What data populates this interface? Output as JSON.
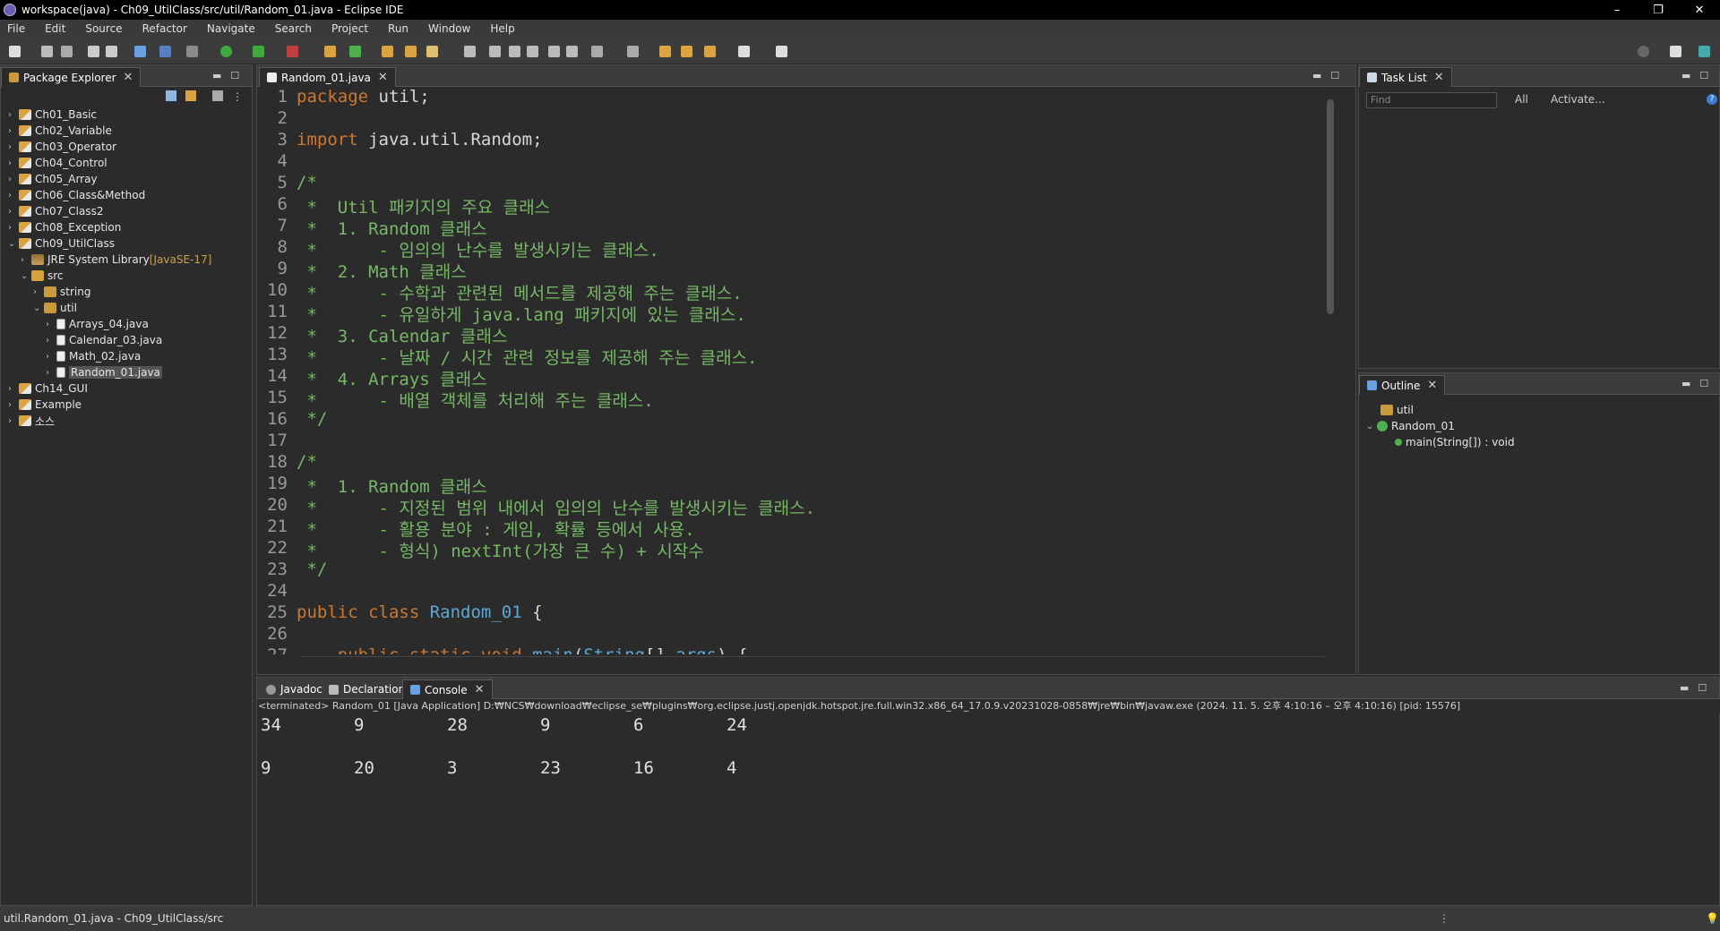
{
  "window": {
    "title": "workspace(java) - Ch09_UtilClass/src/util/Random_01.java - Eclipse IDE",
    "controls": [
      "–",
      "❐",
      "✕"
    ]
  },
  "menu": [
    "File",
    "Edit",
    "Source",
    "Refactor",
    "Navigate",
    "Search",
    "Project",
    "Run",
    "Window",
    "Help"
  ],
  "package_explorer": {
    "tab_label": "Package Explorer",
    "items": [
      {
        "label": "Ch01_Basic",
        "level": 0,
        "icon": "project-icon"
      },
      {
        "label": "Ch02_Variable",
        "level": 0,
        "icon": "project-icon"
      },
      {
        "label": "Ch03_Operator",
        "level": 0,
        "icon": "project-icon"
      },
      {
        "label": "Ch04_Control",
        "level": 0,
        "icon": "project-icon"
      },
      {
        "label": "Ch05_Array",
        "level": 0,
        "icon": "project-icon"
      },
      {
        "label": "Ch06_Class&Method",
        "level": 0,
        "icon": "project-icon"
      },
      {
        "label": "Ch07_Class2",
        "level": 0,
        "icon": "project-icon"
      },
      {
        "label": "Ch08_Exception",
        "level": 0,
        "icon": "project-icon"
      },
      {
        "label": "Ch09_UtilClass",
        "level": 0,
        "icon": "project-icon",
        "expanded": true
      },
      {
        "label": "JRE System Library",
        "suffix": "[JavaSE-17]",
        "level": 1,
        "icon": "library-icon"
      },
      {
        "label": "src",
        "level": 1,
        "icon": "folder-icon",
        "expanded": true
      },
      {
        "label": "string",
        "level": 2,
        "icon": "package-icon"
      },
      {
        "label": "util",
        "level": 2,
        "icon": "package-icon",
        "expanded": true
      },
      {
        "label": "Arrays_04.java",
        "level": 3,
        "icon": "java-file-icon"
      },
      {
        "label": "Calendar_03.java",
        "level": 3,
        "icon": "java-file-icon"
      },
      {
        "label": "Math_02.java",
        "level": 3,
        "icon": "java-file-icon"
      },
      {
        "label": "Random_01.java",
        "level": 3,
        "icon": "java-file-icon",
        "selected": true
      },
      {
        "label": "Ch14_GUI",
        "level": 0,
        "icon": "project-icon"
      },
      {
        "label": "Example",
        "level": 0,
        "icon": "project-icon"
      },
      {
        "label": "소스",
        "level": 0,
        "icon": "project-icon"
      }
    ]
  },
  "editor": {
    "tab_label": "Random_01.java",
    "lines": [
      {
        "n": "1",
        "parts": [
          [
            "kw",
            "package"
          ],
          [
            "pl",
            " util;"
          ]
        ]
      },
      {
        "n": "2",
        "parts": []
      },
      {
        "n": "3",
        "parts": [
          [
            "kw",
            "import"
          ],
          [
            "pl",
            " java.util.Random;"
          ]
        ]
      },
      {
        "n": "4",
        "parts": []
      },
      {
        "n": "5",
        "parts": [
          [
            "cm",
            "/*"
          ]
        ]
      },
      {
        "n": "6",
        "parts": [
          [
            "cm",
            " *  Util 패키지의 주요 클래스"
          ]
        ]
      },
      {
        "n": "7",
        "parts": [
          [
            "cm",
            " *  1. Random 클래스"
          ]
        ]
      },
      {
        "n": "8",
        "parts": [
          [
            "cm",
            " *      - 임의의 난수를 발생시키는 클래스."
          ]
        ]
      },
      {
        "n": "9",
        "parts": [
          [
            "cm",
            " *  2. Math 클래스"
          ]
        ]
      },
      {
        "n": "10",
        "parts": [
          [
            "cm",
            " *      - 수학과 관련된 메서드를 제공해 주는 클래스."
          ]
        ]
      },
      {
        "n": "11",
        "parts": [
          [
            "cm",
            " *      - 유일하게 java.lang 패키지에 있는 클래스."
          ]
        ]
      },
      {
        "n": "12",
        "parts": [
          [
            "cm",
            " *  3. Calendar 클래스"
          ]
        ]
      },
      {
        "n": "13",
        "parts": [
          [
            "cm",
            " *      - 날짜 / 시간 관련 정보를 제공해 주는 클래스."
          ]
        ]
      },
      {
        "n": "14",
        "parts": [
          [
            "cm",
            " *  4. Arrays 클래스"
          ]
        ]
      },
      {
        "n": "15",
        "parts": [
          [
            "cm",
            " *      - 배열 객체를 처리해 주는 클래스."
          ]
        ]
      },
      {
        "n": "16",
        "parts": [
          [
            "cm",
            " */"
          ]
        ]
      },
      {
        "n": "17",
        "parts": []
      },
      {
        "n": "18",
        "parts": [
          [
            "cm",
            "/*"
          ]
        ]
      },
      {
        "n": "19",
        "parts": [
          [
            "cm",
            " *  1. Random 클래스"
          ]
        ]
      },
      {
        "n": "20",
        "parts": [
          [
            "cm",
            " *      - 지정된 범위 내에서 임의의 난수를 발생시키는 클래스."
          ]
        ]
      },
      {
        "n": "21",
        "parts": [
          [
            "cm",
            " *      - 활용 분야 : 게임, 확률 등에서 사용."
          ]
        ]
      },
      {
        "n": "22",
        "parts": [
          [
            "cm",
            " *      - 형식) nextInt(가장 큰 수) + 시작수"
          ]
        ]
      },
      {
        "n": "23",
        "parts": [
          [
            "cm",
            " */"
          ]
        ]
      },
      {
        "n": "24",
        "parts": []
      },
      {
        "n": "25",
        "parts": [
          [
            "kw",
            "public class "
          ],
          [
            "ty",
            "Random_01"
          ],
          [
            "pl",
            " {"
          ]
        ]
      },
      {
        "n": "26",
        "parts": []
      },
      {
        "n": "27",
        "parts": [
          [
            "pl",
            "    "
          ],
          [
            "kw",
            "public static void "
          ],
          [
            "ty",
            "main"
          ],
          [
            "pl",
            "("
          ],
          [
            "ty",
            "String"
          ],
          [
            "pl",
            "[] "
          ],
          [
            "ty",
            "args"
          ],
          [
            "pl",
            ") {"
          ]
        ]
      }
    ]
  },
  "task_list": {
    "tab_label": "Task List",
    "find_placeholder": "Find",
    "all_label": "All",
    "activate_label": "Activate..."
  },
  "outline": {
    "tab_label": "Outline",
    "items": [
      {
        "label": "util",
        "icon": "package-icon"
      },
      {
        "label": "Random_01",
        "icon": "class-icon"
      },
      {
        "label": "main(String[]) : void",
        "icon": "method-icon"
      }
    ]
  },
  "bottom_tabs": [
    "Javadoc",
    "Declaration",
    "Console"
  ],
  "console": {
    "header": "<terminated> Random_01 [Java Application] D:₩NCS₩download₩eclipse_se₩plugins₩org.eclipse.justj.openjdk.hotspot.jre.full.win32.x86_64_17.0.9.v20231028-0858₩jre₩bin₩javaw.exe  (2024. 11. 5. 오후 4:10:16 – 오후 4:10:16) [pid: 15576]",
    "rows": [
      [
        "34",
        "9",
        "28",
        "9",
        "6",
        "24"
      ],
      [
        "9",
        "20",
        "3",
        "23",
        "16",
        "4"
      ]
    ]
  },
  "status_bar": {
    "text": "util.Random_01.java - Ch09_UtilClass/src"
  },
  "colors": {
    "keyword": "#cc7832",
    "comment": "#77b767",
    "type": "#5fa8d3",
    "background": "#2b2b2b"
  }
}
